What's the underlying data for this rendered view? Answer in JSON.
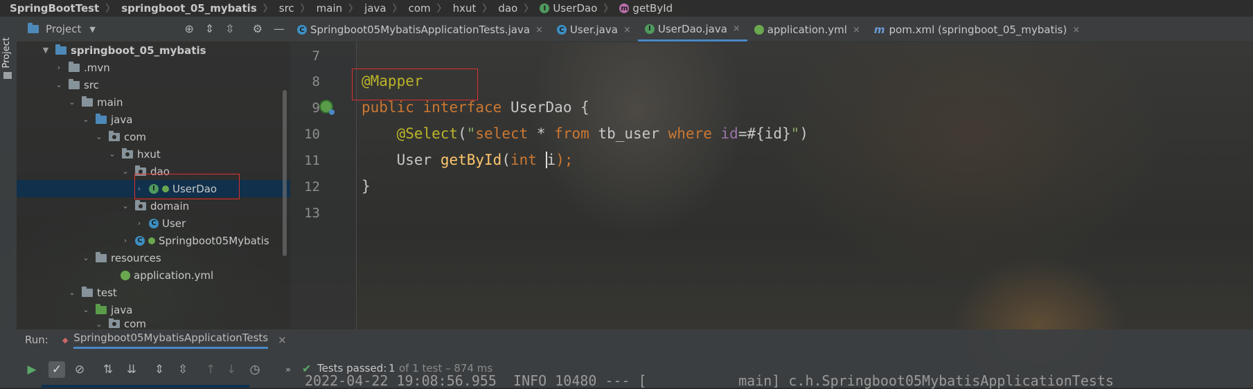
{
  "breadcrumb": {
    "items": [
      "SpringBootTest",
      "springboot_05_mybatis",
      "src",
      "main",
      "java",
      "com",
      "hxut",
      "dao",
      "UserDao",
      "getById"
    ]
  },
  "project_panel": {
    "side_tab": "Project",
    "title": "Project",
    "tree": [
      {
        "label": "springboot_05_mybatis",
        "bold": true
      },
      {
        "label": ".mvn"
      },
      {
        "label": "src"
      },
      {
        "label": "main"
      },
      {
        "label": "java"
      },
      {
        "label": "com"
      },
      {
        "label": "hxut"
      },
      {
        "label": "dao"
      },
      {
        "label": "UserDao",
        "selected": true
      },
      {
        "label": "domain"
      },
      {
        "label": "User"
      },
      {
        "label": "Springboot05Mybatis"
      },
      {
        "label": "resources"
      },
      {
        "label": "application.yml"
      },
      {
        "label": "test"
      },
      {
        "label": "java"
      },
      {
        "label": "com"
      }
    ]
  },
  "tabs": [
    {
      "label": "Springboot05MybatisApplicationTests.java",
      "close": "×",
      "icon": "test-class-icon"
    },
    {
      "label": "User.java",
      "close": "×",
      "icon": "class-icon"
    },
    {
      "label": "UserDao.java",
      "close": "×",
      "icon": "interface-icon",
      "active": true
    },
    {
      "label": "application.yml",
      "close": "×",
      "icon": "spring-config-icon"
    },
    {
      "label": "pom.xml (springboot_05_mybatis)",
      "close": "×",
      "icon": "maven-icon"
    }
  ],
  "editor": {
    "line_numbers": [
      "7",
      "8",
      "9",
      "10",
      "11",
      "12",
      "13"
    ],
    "code": {
      "l8_annotation": "@Mapper",
      "l9_kw1": "public",
      "l9_kw2": "interface",
      "l9_name": "UserDao",
      "l9_brace": "{",
      "l10_annotation": "@Select",
      "l10_paren_open": "(",
      "l10_str_q": "\"",
      "l10_select": "select",
      "l10_star": "*",
      "l10_from": "from",
      "l10_table": "tb_user",
      "l10_where": "where",
      "l10_id": "id",
      "l10_rest": "=#{id}",
      "l10_str_end": "\"",
      "l10_paren_close": ")",
      "l11_type": "User",
      "l11_method": "getById",
      "l11_paren": "(",
      "l11_kw": "int",
      "l11_param": "i",
      "l11_end": ");",
      "l12_brace": "}"
    }
  },
  "run_panel": {
    "label": "Run:",
    "config_name": "Springboot05MybatisApplicationTests",
    "close": "×",
    "status_prefix": "Tests passed:",
    "status_count": "1",
    "status_detail": "of 1 test – 874 ms",
    "console_line": "2022-04-22 19:08:56.955  INFO 10480 --- [           main] c.h.Springboot05MybatisApplicationTests"
  },
  "colors": {
    "keyword": "#cc7832",
    "annotation": "#bbb529",
    "string": "#8ca76a",
    "method": "#ffc66d",
    "field": "#9876aa",
    "highlight_box": "#e03030",
    "selection": "#0d3150",
    "tab_underline": "#4a88c7"
  }
}
